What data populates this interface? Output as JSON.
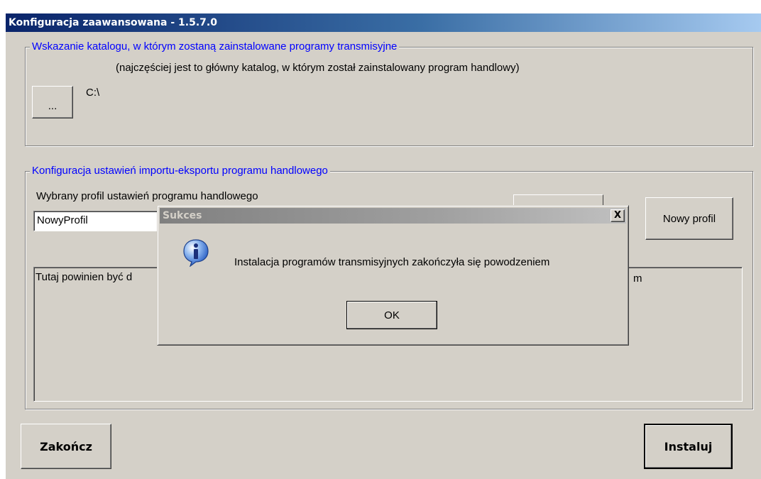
{
  "window": {
    "title": "Konfiguracja zaawansowana - 1.5.7.0"
  },
  "install_dir_group": {
    "legend": "Wskazanie katalogu, w którym zostaną zainstalowane programy transmisyjne",
    "hint": "(najczęściej jest to główny katalog, w którym został zainstalowany program handlowy)",
    "browse_label": "...",
    "path": "C:\\"
  },
  "import_export_group": {
    "legend": "Konfiguracja ustawień importu-eksportu programu handlowego",
    "profile_label": "Wybrany profil ustawień programu handlowego",
    "profile_value": "NowyProfil",
    "new_profile_label": "Nowy profil",
    "info_text_left": "Tutaj powinien być d",
    "info_text_right": "m"
  },
  "footer": {
    "finish_label": "Zakończ",
    "install_label": "Instaluj"
  },
  "dialog": {
    "title": "Sukces",
    "close_label": "X",
    "message": "Instalacja programów transmisyjnych zakończyła się powodzeniem",
    "ok_label": "OK",
    "icon": "info-icon"
  }
}
